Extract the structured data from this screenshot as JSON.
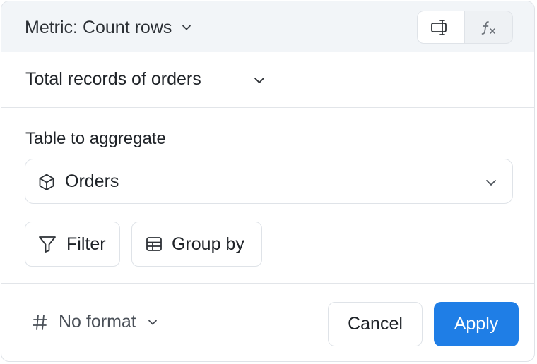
{
  "header": {
    "metric_label": "Metric: Count rows",
    "view_toggle": {
      "active": "visual",
      "options": [
        {
          "name": "visual",
          "icon": "visual-builder-icon"
        },
        {
          "name": "formula",
          "icon": "function-icon",
          "text": "fx"
        }
      ]
    }
  },
  "name_row": {
    "title": "Total records of orders"
  },
  "table_section": {
    "label": "Table to aggregate",
    "selected_table": "Orders",
    "table_icon": "cube-icon"
  },
  "actions": {
    "filter_label": "Filter",
    "group_by_label": "Group by"
  },
  "footer": {
    "format_label": "No format",
    "format_icon": "hash-icon",
    "cancel_label": "Cancel",
    "apply_label": "Apply"
  },
  "colors": {
    "accent": "#1f7ee6",
    "header_bg": "#f2f5f8",
    "border": "#dfe3e8"
  }
}
